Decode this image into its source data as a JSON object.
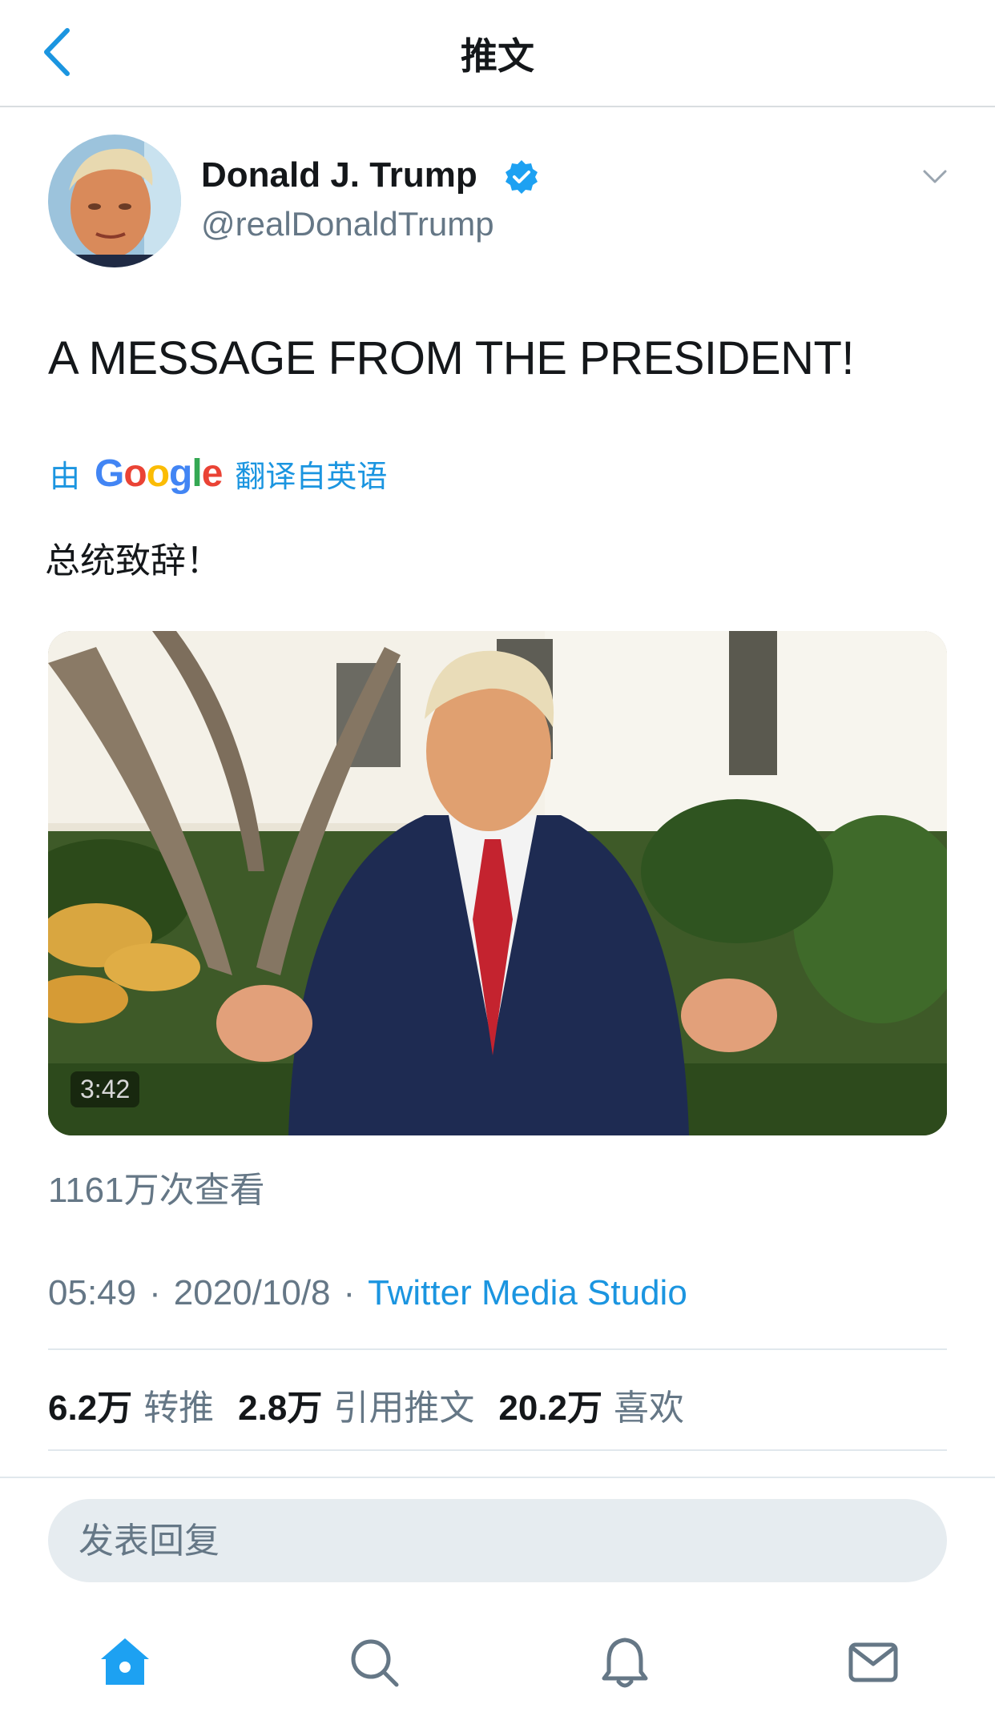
{
  "header": {
    "title": "推文"
  },
  "author": {
    "name": "Donald J. Trump",
    "handle": "@realDonaldTrump"
  },
  "tweet": {
    "text": "A MESSAGE FROM THE PRESIDENT!"
  },
  "translation": {
    "by": "由",
    "provider": "Google",
    "note": "翻译自英语",
    "text": "总统致辞！"
  },
  "video": {
    "duration": "3:42"
  },
  "views": "1161万次查看",
  "meta": {
    "time": "05:49",
    "separator": "·",
    "date": "2020/10/8",
    "source": "Twitter Media Studio"
  },
  "stats": [
    {
      "num": "6.2万",
      "label": "转推"
    },
    {
      "num": "2.8万",
      "label": "引用推文"
    },
    {
      "num": "20.2万",
      "label": "喜欢"
    }
  ],
  "reply": {
    "placeholder": "发表回复"
  },
  "colors": {
    "accent": "#1b95e0",
    "muted": "#657786",
    "text": "#14171a"
  },
  "icons": [
    "back-icon",
    "verified-icon",
    "chevron-down-icon",
    "home-icon",
    "search-icon",
    "notifications-icon",
    "messages-icon"
  ]
}
